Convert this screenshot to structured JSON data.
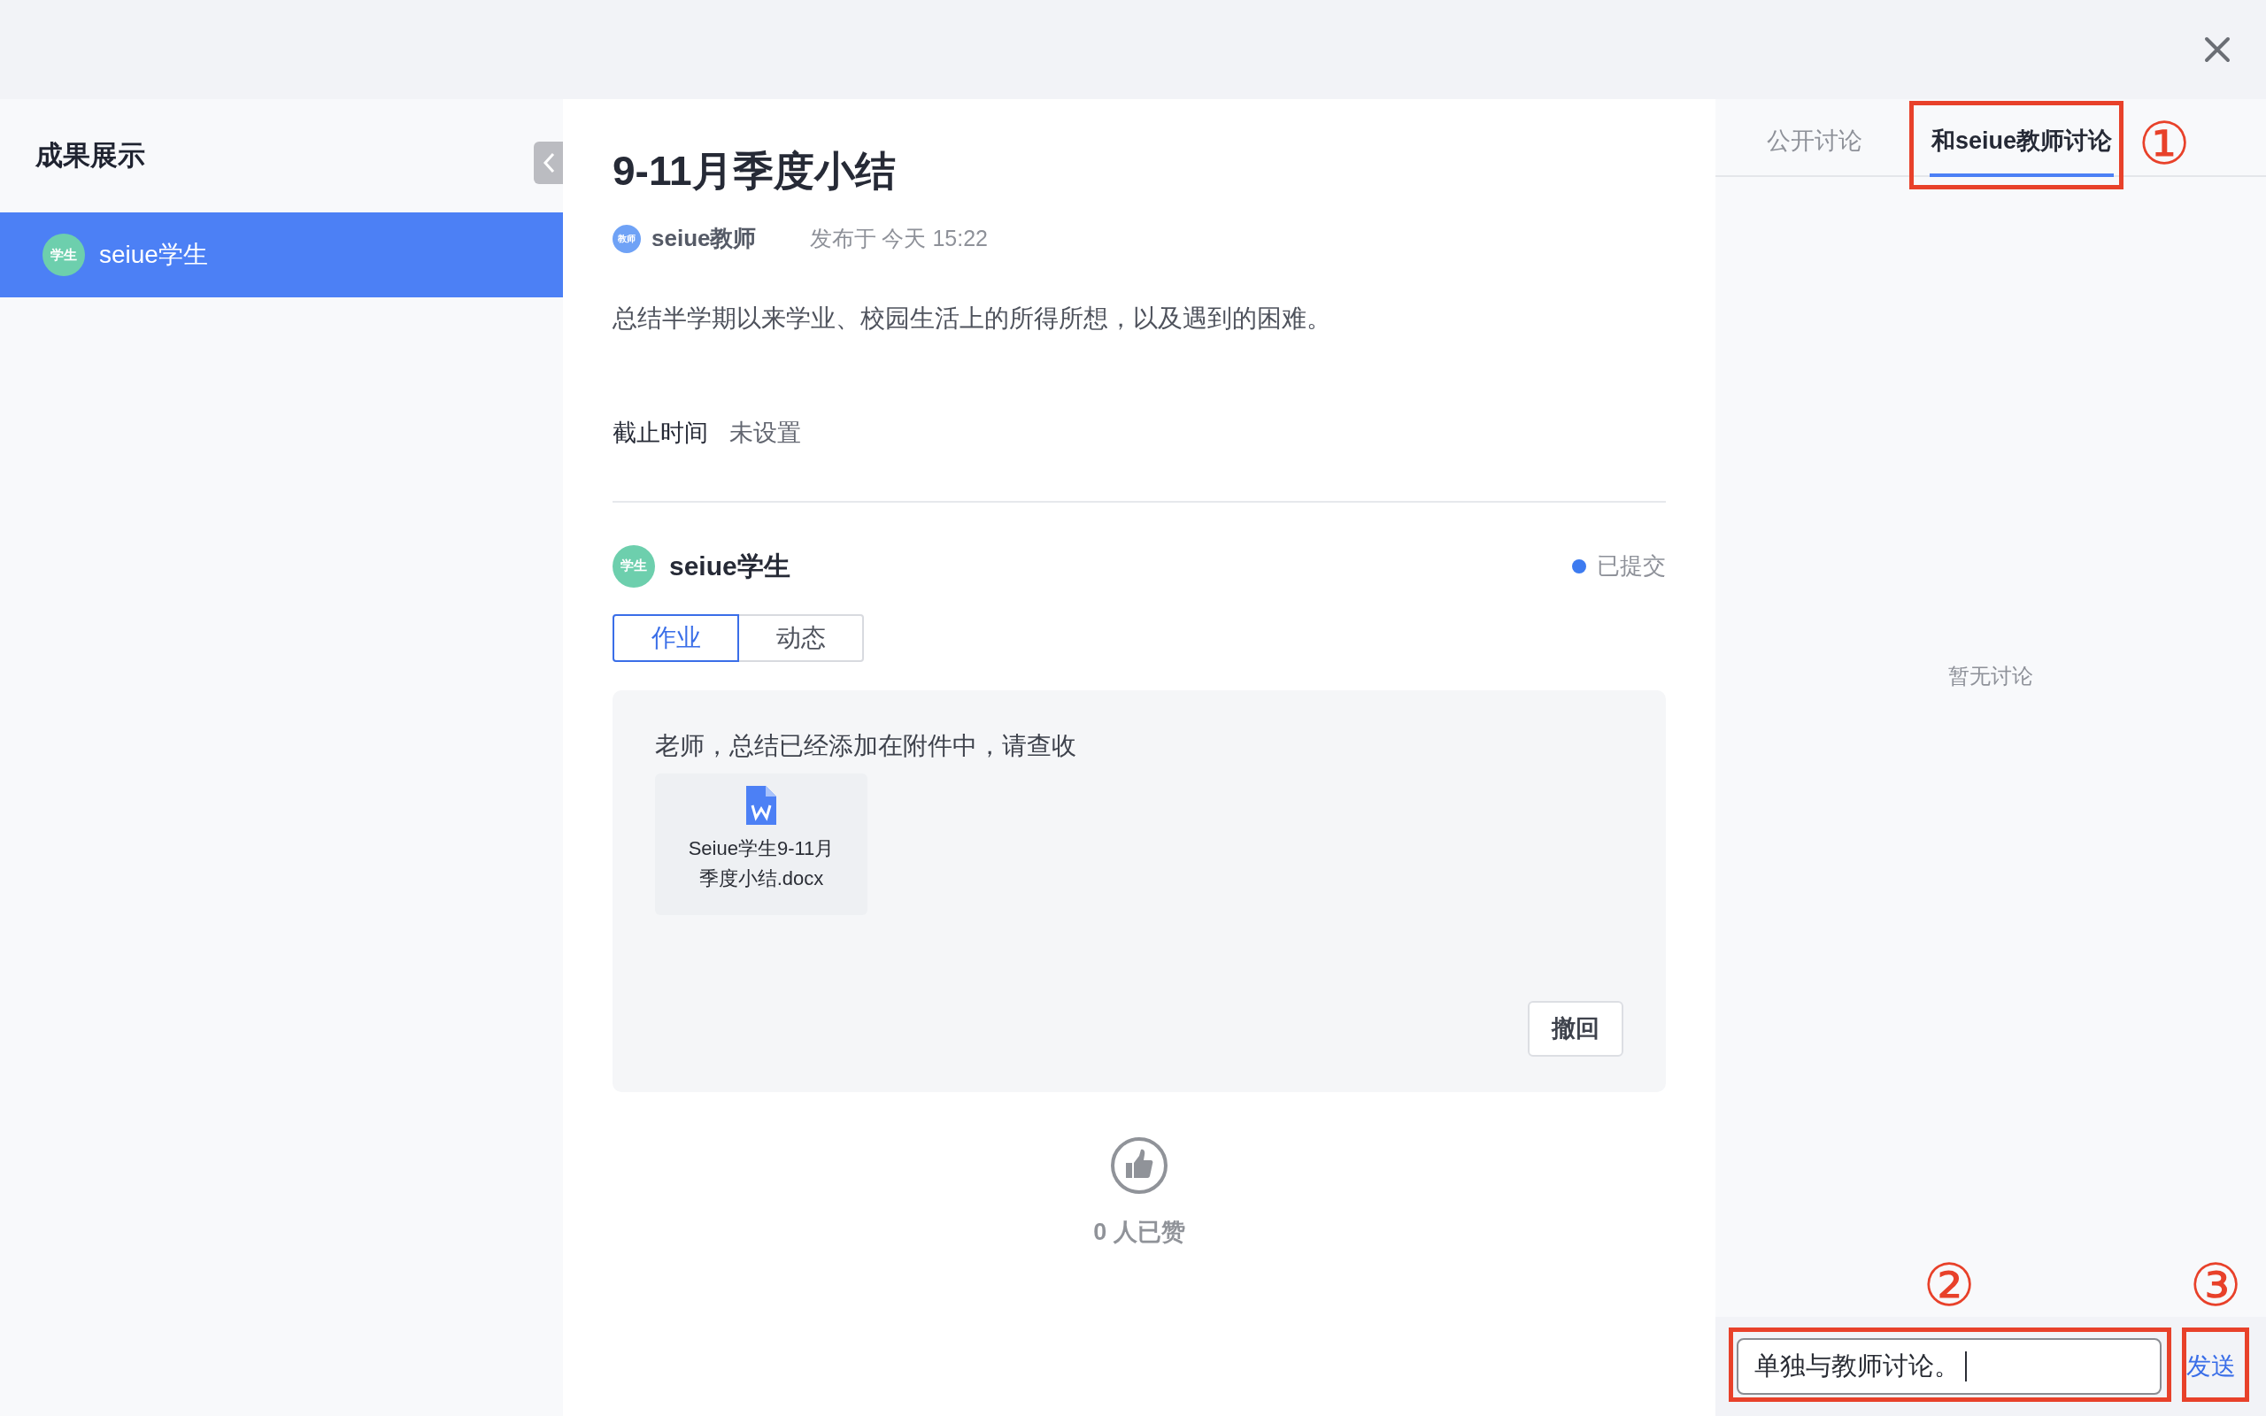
{
  "sidebar": {
    "title": "成果展示",
    "items": [
      {
        "avatar": "学生",
        "name": "seiue学生",
        "selected": true
      }
    ]
  },
  "assignment": {
    "title": "9-11月季度小结",
    "author": {
      "avatar": "教师",
      "name": "seiue教师"
    },
    "published": "发布于 今天 15:22",
    "description": "总结半学期以来学业、校园生活上的所得所想，以及遇到的困难。",
    "deadline": {
      "label": "截止时间",
      "value": "未设置"
    }
  },
  "submission": {
    "student": {
      "avatar": "学生",
      "name": "seiue学生"
    },
    "status": "已提交",
    "tabs": [
      {
        "label": "作业",
        "selected": true
      },
      {
        "label": "动态",
        "selected": false
      }
    ],
    "message": "老师，总结已经添加在附件中，请查收",
    "attachments": [
      {
        "name": "Seiue学生9-11月季度小结.docx"
      }
    ],
    "revoke_button": "撤回"
  },
  "likes": {
    "text": "0 人已赞"
  },
  "discussion": {
    "tabs": [
      {
        "label": "公开讨论",
        "selected": false
      },
      {
        "label": "和seiue教师讨论",
        "selected": true
      }
    ],
    "empty_text": "暂无讨论",
    "input": {
      "value": "单独与教师讨论。"
    },
    "send_button": "发送"
  },
  "annotations": [
    {
      "number": "①"
    },
    {
      "number": "②"
    },
    {
      "number": "③"
    }
  ]
}
